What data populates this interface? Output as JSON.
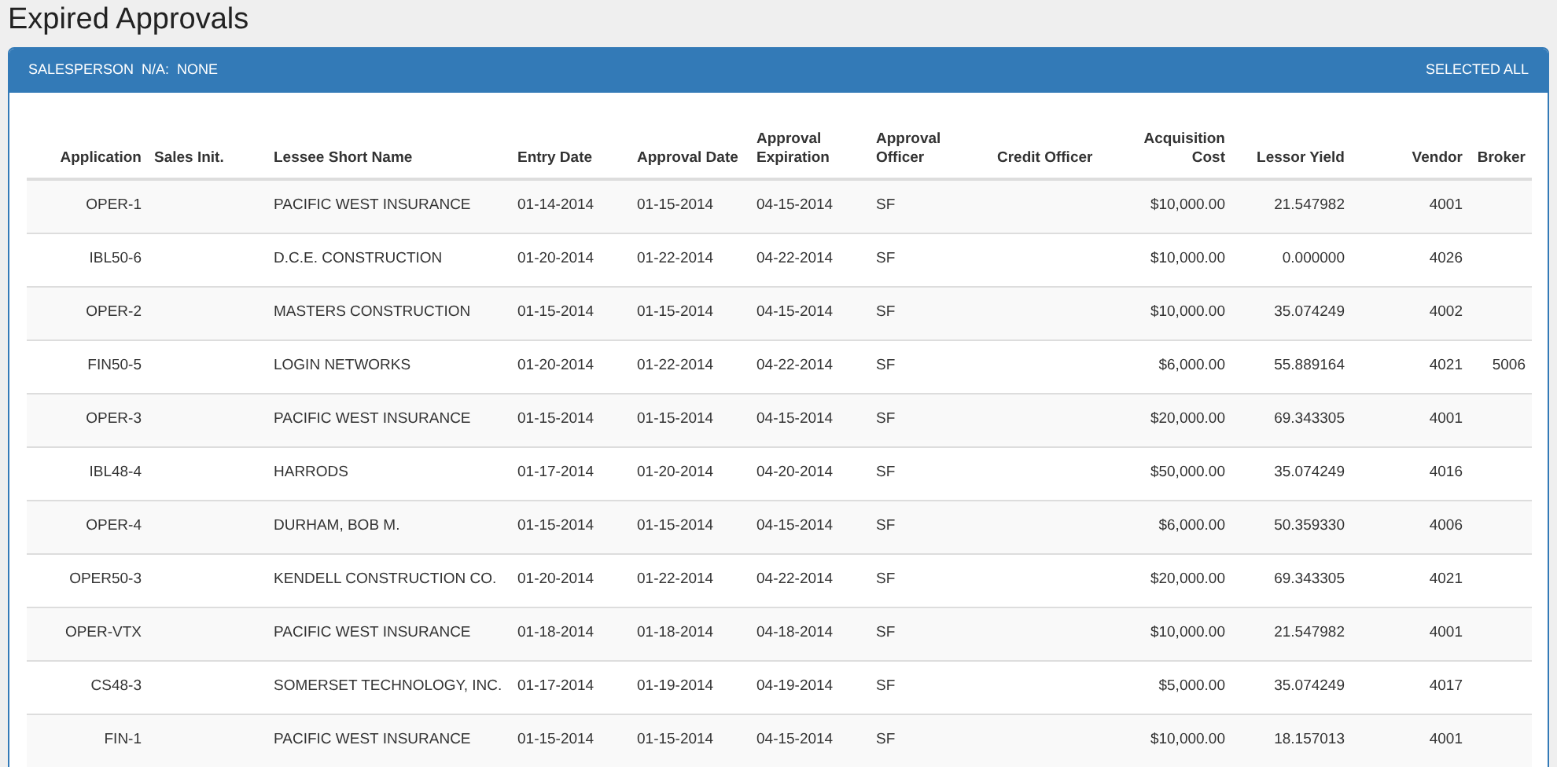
{
  "page_title": "Expired Approvals",
  "panel": {
    "filter_label": "SALESPERSON",
    "filter_key": "N/A:",
    "filter_value": "NONE",
    "selection_status": "SELECTED ALL"
  },
  "table": {
    "columns": [
      "Application",
      "Sales Init.",
      "Lessee Short Name",
      "Entry Date",
      "Approval Date",
      "Approval Expiration",
      "Approval Officer",
      "Credit Officer",
      "Acquisition Cost",
      "Lessor Yield",
      "Vendor",
      "Broker"
    ],
    "rows": [
      {
        "application": "OPER-1",
        "lessee_short_name": "PACIFIC WEST INSURANCE",
        "entry_date": "01-14-2014",
        "approval_date": "01-15-2014",
        "approval_expiration": "04-15-2014",
        "approval_officer": "SF",
        "acquisition_cost": "$10,000.00",
        "lessor_yield": "21.547982",
        "vendor": "4001"
      },
      {
        "application": "IBL50-6",
        "lessee_short_name": "D.C.E. CONSTRUCTION",
        "entry_date": "01-20-2014",
        "approval_date": "01-22-2014",
        "approval_expiration": "04-22-2014",
        "approval_officer": "SF",
        "acquisition_cost": "$10,000.00",
        "lessor_yield": "0.000000",
        "vendor": "4026"
      },
      {
        "application": "OPER-2",
        "lessee_short_name": "MASTERS CONSTRUCTION",
        "entry_date": "01-15-2014",
        "approval_date": "01-15-2014",
        "approval_expiration": "04-15-2014",
        "approval_officer": "SF",
        "acquisition_cost": "$10,000.00",
        "lessor_yield": "35.074249",
        "vendor": "4002"
      },
      {
        "application": "FIN50-5",
        "lessee_short_name": "LOGIN NETWORKS",
        "entry_date": "01-20-2014",
        "approval_date": "01-22-2014",
        "approval_expiration": "04-22-2014",
        "approval_officer": "SF",
        "acquisition_cost": "$6,000.00",
        "lessor_yield": "55.889164",
        "vendor": "4021",
        "broker": "5006"
      },
      {
        "application": "OPER-3",
        "lessee_short_name": "PACIFIC WEST INSURANCE",
        "entry_date": "01-15-2014",
        "approval_date": "01-15-2014",
        "approval_expiration": "04-15-2014",
        "approval_officer": "SF",
        "acquisition_cost": "$20,000.00",
        "lessor_yield": "69.343305",
        "vendor": "4001"
      },
      {
        "application": "IBL48-4",
        "lessee_short_name": "HARRODS",
        "entry_date": "01-17-2014",
        "approval_date": "01-20-2014",
        "approval_expiration": "04-20-2014",
        "approval_officer": "SF",
        "acquisition_cost": "$50,000.00",
        "lessor_yield": "35.074249",
        "vendor": "4016"
      },
      {
        "application": "OPER-4",
        "lessee_short_name": "DURHAM, BOB M.",
        "entry_date": "01-15-2014",
        "approval_date": "01-15-2014",
        "approval_expiration": "04-15-2014",
        "approval_officer": "SF",
        "acquisition_cost": "$6,000.00",
        "lessor_yield": "50.359330",
        "vendor": "4006"
      },
      {
        "application": "OPER50-3",
        "lessee_short_name": "KENDELL CONSTRUCTION CO.",
        "entry_date": "01-20-2014",
        "approval_date": "01-22-2014",
        "approval_expiration": "04-22-2014",
        "approval_officer": "SF",
        "acquisition_cost": "$20,000.00",
        "lessor_yield": "69.343305",
        "vendor": "4021"
      },
      {
        "application": "OPER-VTX",
        "lessee_short_name": "PACIFIC WEST INSURANCE",
        "entry_date": "01-18-2014",
        "approval_date": "01-18-2014",
        "approval_expiration": "04-18-2014",
        "approval_officer": "SF",
        "acquisition_cost": "$10,000.00",
        "lessor_yield": "21.547982",
        "vendor": "4001"
      },
      {
        "application": "CS48-3",
        "lessee_short_name": "SOMERSET TECHNOLOGY, INC.",
        "entry_date": "01-17-2014",
        "approval_date": "01-19-2014",
        "approval_expiration": "04-19-2014",
        "approval_officer": "SF",
        "acquisition_cost": "$5,000.00",
        "lessor_yield": "35.074249",
        "vendor": "4017"
      },
      {
        "application": "FIN-1",
        "lessee_short_name": "PACIFIC WEST INSURANCE",
        "entry_date": "01-15-2014",
        "approval_date": "01-15-2014",
        "approval_expiration": "04-15-2014",
        "approval_officer": "SF",
        "acquisition_cost": "$10,000.00",
        "lessor_yield": "18.157013",
        "vendor": "4001"
      }
    ]
  }
}
